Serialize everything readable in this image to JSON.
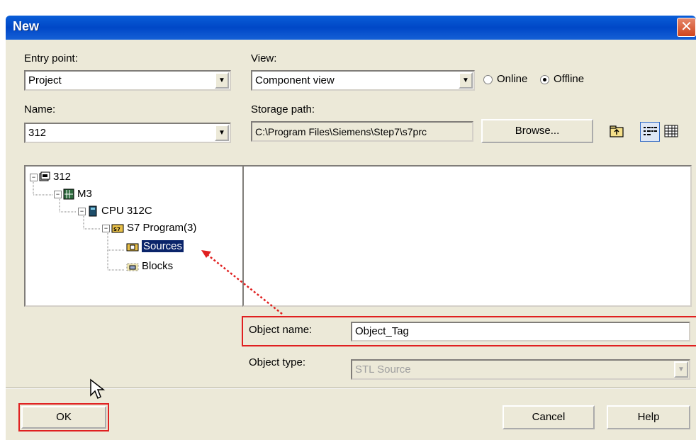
{
  "window": {
    "title": "New",
    "close_glyph": "✕"
  },
  "entry_point": {
    "label": "Entry point:",
    "value": "Project"
  },
  "view": {
    "label": "View:",
    "value": "Component view"
  },
  "mode": {
    "online_label": "Online",
    "offline_label": "Offline",
    "selected": "Offline"
  },
  "name": {
    "label": "Name:",
    "value": "312"
  },
  "storage": {
    "label": "Storage path:",
    "value": "C:\\Program Files\\Siemens\\Step7\\s7prc",
    "browse_label": "Browse..."
  },
  "tree": {
    "items": [
      {
        "label": "312",
        "icon": "project-icon"
      },
      {
        "label": "M3",
        "icon": "station-icon"
      },
      {
        "label": "CPU 312C",
        "icon": "cpu-icon"
      },
      {
        "label": "S7 Program(3)",
        "icon": "s7-program-icon"
      },
      {
        "label": "Sources",
        "icon": "sources-folder-icon",
        "selected": true
      },
      {
        "label": "Blocks",
        "icon": "blocks-folder-icon"
      }
    ]
  },
  "object_name": {
    "label": "Object name:",
    "value": "Object_Tag"
  },
  "object_type": {
    "label": "Object type:",
    "value": "STL Source"
  },
  "buttons": {
    "ok": "OK",
    "cancel": "Cancel",
    "help": "Help"
  },
  "colors": {
    "title_bar": "#0047c7",
    "dialog_bg": "#ece9d8",
    "selection": "#0a246a",
    "highlight_box": "#e02020"
  }
}
